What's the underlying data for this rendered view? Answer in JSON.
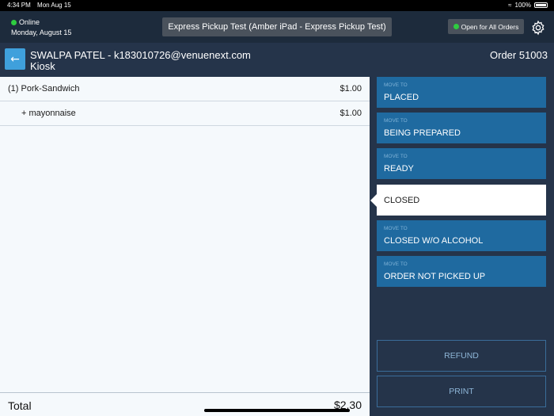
{
  "statusbar": {
    "time": "4:34 PM",
    "date": "Mon Aug 15",
    "battery": "100%"
  },
  "header": {
    "status": "Online",
    "date": "Monday, August 15",
    "store": "Express Pickup Test (Amber iPad - Express Pickup Test)",
    "open_orders": "Open for All Orders"
  },
  "order": {
    "customer": "SWALPA PATEL - k183010726@venuenext.com",
    "source": "Kiosk",
    "number": "Order 51003"
  },
  "items": [
    {
      "label": "(1) Pork-Sandwich",
      "price": "$1.00"
    },
    {
      "label": "+ mayonnaise",
      "price": "$1.00"
    }
  ],
  "total": {
    "label": "Total",
    "value": "$2.30"
  },
  "status_buttons": [
    {
      "hint": "MOVE TO",
      "name": "PLACED"
    },
    {
      "hint": "MOVE TO",
      "name": "BEING PREPARED"
    },
    {
      "hint": "MOVE TO",
      "name": "READY"
    },
    {
      "hint": "",
      "name": "CLOSED"
    },
    {
      "hint": "MOVE TO",
      "name": "CLOSED W/O ALCOHOL"
    },
    {
      "hint": "MOVE TO",
      "name": "ORDER NOT PICKED UP"
    }
  ],
  "actions": {
    "refund": "REFUND",
    "print": "PRINT"
  },
  "colors": {
    "accent": "#1f6aa0",
    "back": "#3fa0dc",
    "online": "#2ecc40"
  }
}
